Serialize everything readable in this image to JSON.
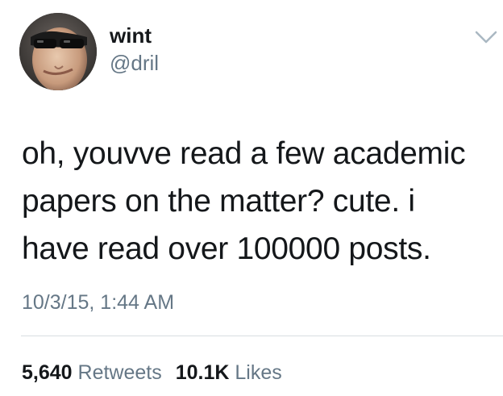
{
  "author": {
    "display_name": "wint",
    "handle": "@dril",
    "avatar_icon": "profile-photo"
  },
  "header": {
    "menu_icon": "chevron-down-icon"
  },
  "tweet": {
    "lines": [
      "oh, youvve read a few academic",
      "papers on the matter? cute. i",
      "have read over 100000 posts."
    ],
    "timestamp": "10/3/15, 1:44 AM"
  },
  "stats": {
    "retweets_count": "5,640",
    "retweets_label": "Retweets",
    "likes_count": "10.1K",
    "likes_label": "Likes"
  },
  "colors": {
    "primary_text": "#14171a",
    "secondary_text": "#657786",
    "divider": "#d8dde1",
    "background": "#ffffff"
  }
}
